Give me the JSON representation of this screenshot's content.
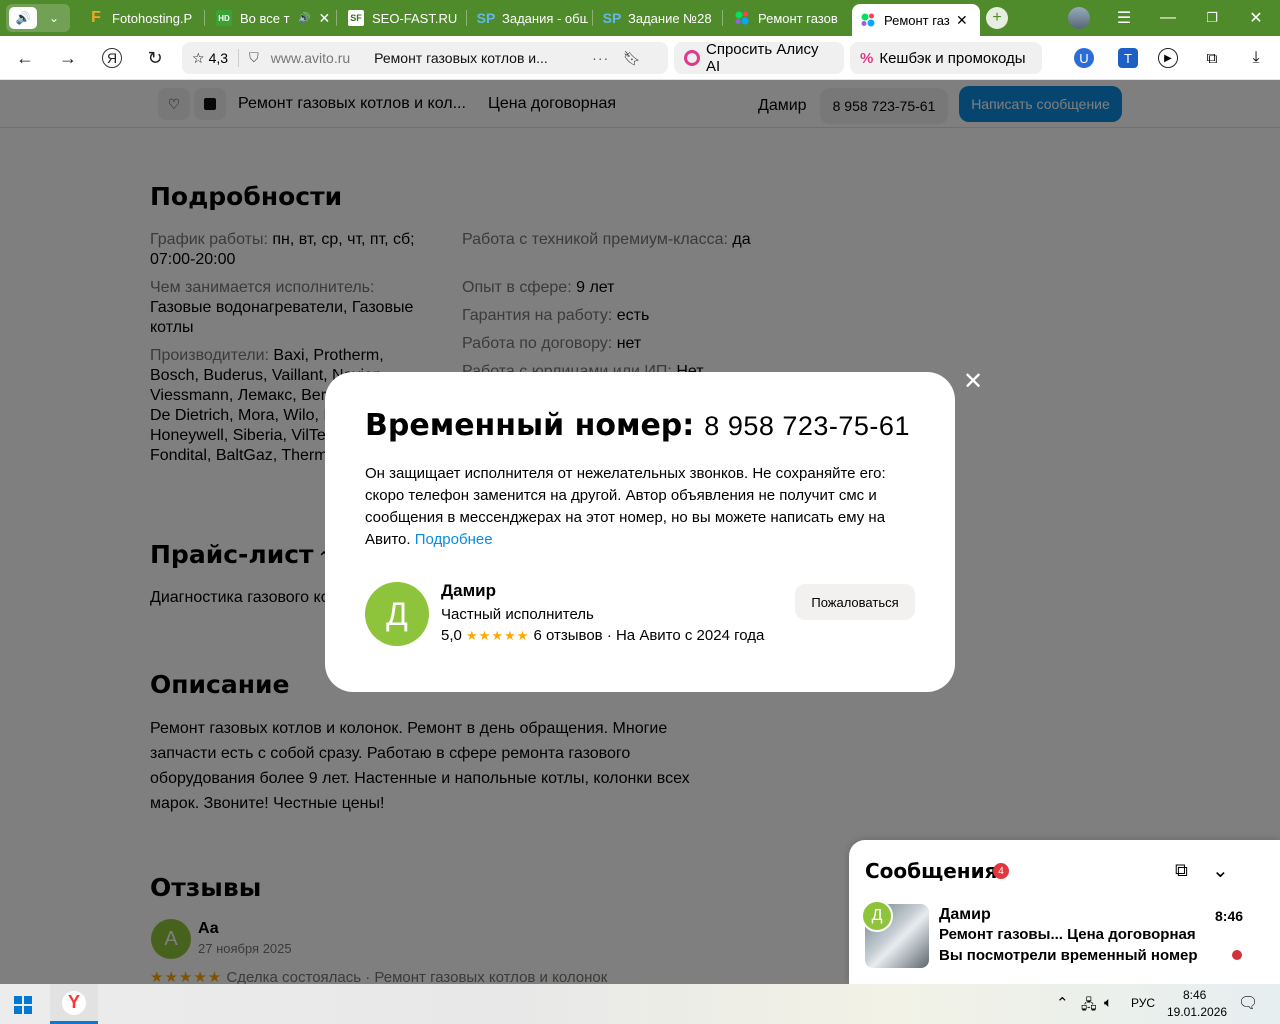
{
  "browser": {
    "tabs": [
      {
        "title": "Fotohosting.P",
        "icon_name": "fotohosting-icon",
        "icon_text": "F"
      },
      {
        "title": "Во все т",
        "icon_name": "hd-video-icon",
        "icon_text": "HD"
      },
      {
        "title": "SEO-FAST.RU",
        "icon_name": "seofast-icon",
        "icon_text": "SF"
      },
      {
        "title": "Задания - обш",
        "icon_name": "sp-icon",
        "icon_text": "SP"
      },
      {
        "title": "Задание №28",
        "icon_name": "sp-icon",
        "icon_text": "SP"
      },
      {
        "title": "Ремонт газов",
        "icon_name": "avito-icon",
        "icon_text": ""
      },
      {
        "title": "Ремонт газ",
        "icon_name": "avito-icon",
        "icon_text": ""
      }
    ],
    "rating": "4,3",
    "url_domain": "www.avito.ru",
    "page_title": "Ремонт газовых котлов и...",
    "alice_label": "Спросить Алису AI",
    "cashback_label": "Кешбэк и промокоды"
  },
  "sticky": {
    "title": "Ремонт газовых котлов и кол...",
    "price": "Цена договорная",
    "seller": "Дамир",
    "phone": "8 958 723-75-61",
    "message_button": "Написать сообщение"
  },
  "details": {
    "heading": "Подробности",
    "left": [
      {
        "key": "График работы:",
        "value": "пн, вт, ср, чт, пт, сб; 07:00-20:00"
      },
      {
        "key": "Чем занимается исполнитель:",
        "value": "Газовые водонагреватели, Газовые котлы"
      },
      {
        "key": "Производители:",
        "value": "Baxi, Protherm, Bosch, Buderus, Vaillant, Navien, Viessmann, Лемакс, Beretta, Нева, Sit, De Dietrich, Mora, Wilo, Immergas, Honeywell, Siberia, VilTerm, Daewoo, Fondital, BaltGaz, Thermona"
      }
    ],
    "right": [
      {
        "key": "Работа с техникой премиум-класса:",
        "value": "да"
      },
      {
        "key": "Опыт в сфере:",
        "value": "9 лет"
      },
      {
        "key": "Гарантия на работу:",
        "value": "есть"
      },
      {
        "key": "Работа по договору:",
        "value": "нет"
      },
      {
        "key": "Работа с юрлицами или ИП:",
        "value": "Нет"
      }
    ]
  },
  "pricelist": {
    "heading": "Прайс-лист",
    "item": "Диагностика газового котла"
  },
  "description": {
    "heading": "Описание",
    "text": "Ремонт газовых котлов и колонок. Ремонт в день обращения. Многие запчасти есть с собой сразу. Работаю в сфере ремонта газового оборудования более 9 лет. Настенные и напольные котлы, колонки всех марок. Звоните! Честные цены!"
  },
  "reviews": {
    "heading": "Отзывы",
    "author": "Аа",
    "avatar_letter": "А",
    "date": "27 ноября 2025",
    "stars": "★★★★★",
    "deal": "Сделка состоялась · Ремонт газовых котлов и колонок"
  },
  "modal": {
    "title": "Временный номер:",
    "phone": "8 958 723-75-61",
    "text": "Он защищает исполнителя от нежелательных звонков. Не сохраняйте его: скоро телефон заменится на другой. Автор объявления не получит смс и сообщения в мессенджерах на этот номер, но вы можете написать ему на Авито.",
    "link": "Подробнее",
    "avatar_letter": "Д",
    "seller_name": "Дамир",
    "seller_type": "Частный исполнитель",
    "rating": "5,0",
    "stars": "★★★★★",
    "reviews": "6 отзывов · На Авито с 2024 года",
    "complain": "Пожаловаться"
  },
  "chat": {
    "title": "Сообщения",
    "badge": "4",
    "avatar_letter": "Д",
    "name": "Дамир",
    "time": "8:46",
    "ad_title": "Ремонт газовы...",
    "ad_price": "Цена договорная",
    "last_message": "Вы посмотрели временный номер"
  },
  "taskbar": {
    "lang": "РУС",
    "time": "8:46",
    "date": "19.01.2026"
  },
  "colors": {
    "accent": "#0a8be0",
    "avatar_green": "#8ec43b",
    "star": "#ffa800",
    "tabbar": "#4f8a2b"
  }
}
